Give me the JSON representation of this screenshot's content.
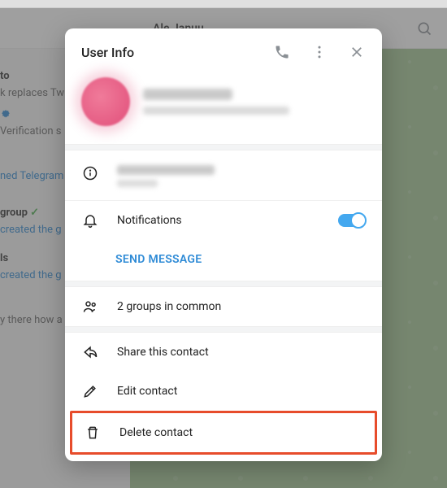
{
  "bg": {
    "header_name": "Ale Januu",
    "side": {
      "title1": "to",
      "line1": "k replaces Twi",
      "verification": "Verification s",
      "joined": "ned Telegram",
      "title2": "group",
      "created1": "created the g",
      "title3": "ls",
      "created2": "created the g",
      "msg": "y there how a"
    }
  },
  "modal": {
    "title": "User Info",
    "notifications": "Notifications",
    "send_message": "SEND MESSAGE",
    "groups_common": "2 groups in common",
    "share": "Share this contact",
    "edit": "Edit contact",
    "delete": "Delete contact"
  }
}
